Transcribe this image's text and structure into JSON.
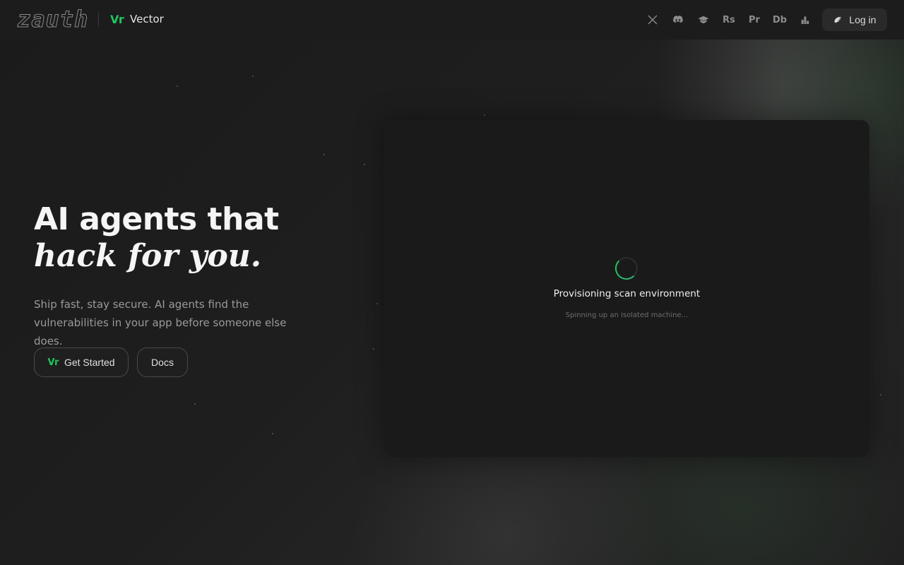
{
  "header": {
    "logo_text": "zauth",
    "brand_mark": "Vr",
    "brand_name": "Vector",
    "social_icons": [
      {
        "name": "x-icon",
        "glyph": "𝕏"
      },
      {
        "name": "discord-icon",
        "glyph": ""
      },
      {
        "name": "book-icon",
        "glyph": ""
      },
      {
        "name": "rs-icon",
        "glyph": "Rs"
      },
      {
        "name": "pr-icon",
        "glyph": "Pr"
      },
      {
        "name": "db-icon",
        "glyph": "Db"
      },
      {
        "name": "leaderboard-icon",
        "glyph": ""
      }
    ],
    "login_label": "Log in"
  },
  "hero": {
    "headline_line1": "AI agents that",
    "headline_line2": "hack for you.",
    "subtitle": "Ship fast, stay secure. AI agents find the vulnerabilities in your app before someone else does.",
    "get_started_label": "Get Started",
    "get_started_mark": "Vr",
    "docs_label": "Docs"
  },
  "panel": {
    "title": "Provisioning scan environment",
    "subtitle": "Spinning up an isolated machine..."
  },
  "colors": {
    "accent": "#22c55e",
    "background": "#1c1c1c",
    "panel": "#1a1a1b"
  }
}
